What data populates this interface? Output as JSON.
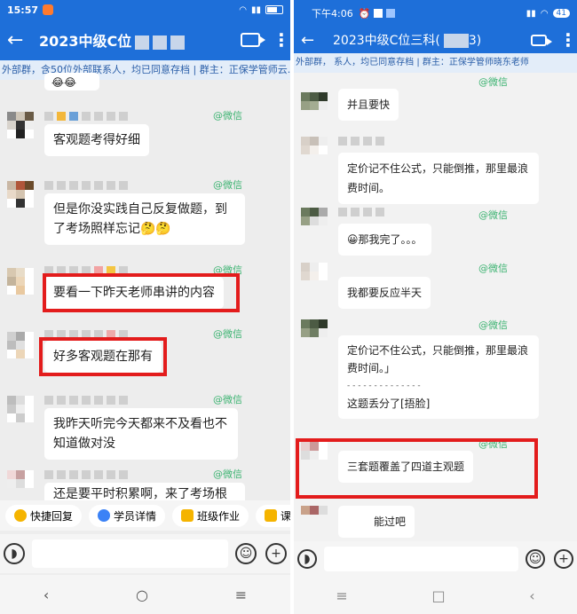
{
  "left": {
    "status_time": "15:57",
    "title": "2023中级C位",
    "notice": "外部群，含50位外部联系人，均已同意存档 | 群主：正保学管师云...",
    "wechat_tag": "@微信",
    "messages": [
      "客观题考得好细",
      "但是你没实践自己反复做题，到了考场照样忘记🤔🤔",
      "要看一下昨天老师串讲的内容",
      "好多客观题在那有",
      "我昨天听完今天都来不及看也不知道做对没",
      "还是要平时积累啊，来了考场根"
    ],
    "toolbar": [
      "快捷回复",
      "学员详情",
      "班级作业",
      "课外拓"
    ],
    "nav": [
      "‹",
      "○",
      "≡"
    ]
  },
  "right": {
    "status_time": "下午4:06",
    "battery": "41",
    "title": "2023中级C位三科(",
    "title_suffix": "3)",
    "notice": "外部群，                  系人，均已同意存档 | 群主：正保学管师晓东老师",
    "wechat_tag": "@微信",
    "messages": [
      "并且要快",
      "定价记不住公式，只能倒推，那里最浪费时间。",
      "😀那我完了。。。",
      "我都要反应半天",
      "定价记不住公式，只能倒推，那里最浪费时间。」",
      "- - - - - - - - - - - - - -",
      "这题丢分了[捂脸]",
      "三套题覆盖了四道主观题",
      "能过吧"
    ],
    "nav": [
      "≡",
      "□",
      "‹"
    ]
  }
}
